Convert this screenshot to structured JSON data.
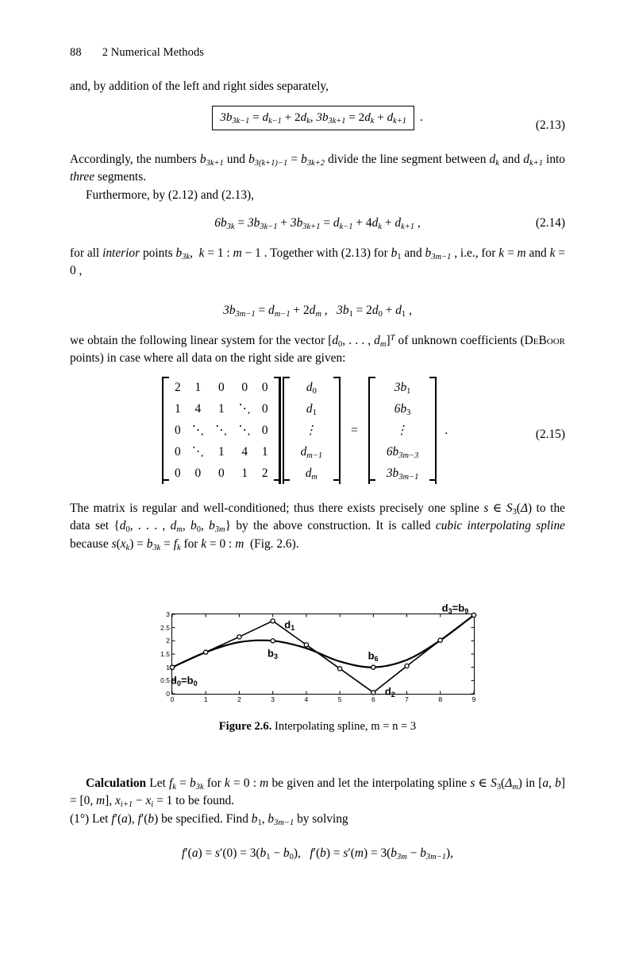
{
  "page": {
    "number": "88",
    "chapter_title": "2  Numerical Methods"
  },
  "body": {
    "para1": "and, by addition of the left and right sides separately,",
    "eq213": {
      "number": "(2.13)",
      "content": "3b_{3k-1} = d_{k-1} + 2d_k,  3b_{3k+1} = 2d_k + d_{k+1}",
      "trailing": "."
    },
    "para2_line1": "Accordingly, the numbers b_{3k+1} und b_{3(k+1)-1} = b_{3k+2} divide the line segment",
    "para2_line2": "between d_k and d_{k+1} into three segments.",
    "para3": "Furthermore, by (2.12) and (2.13),",
    "eq214": {
      "number": "(2.14)",
      "content": "6b_{3k} = 3b_{3k-1} + 3b_{3k+1} = d_{k-1} + 4d_k + d_{k+1} ,"
    },
    "para4_line1": "for all interior points b_{3k}, k = 1 : m - 1. Together with (2.13) for b_1 and",
    "para4_line2": "b_{3m-1}, i.e., for k = m and k = 0,",
    "eq_unnumbered": "3b_{3m-1} = d_{m-1} + 2d_m ,   3b_1 = 2d_0 + d_1 ,",
    "para5_line1": "we obtain the following linear system for the vector [d_0, ... , d_m]^T of unknown",
    "para5_line2": "coefficients (DeBoor points) in case where all data on the right side are given:",
    "eq215": {
      "number": "(2.15)",
      "trailing": ".",
      "matrix": [
        [
          "2",
          "1",
          "0",
          "0",
          "0"
        ],
        [
          "1",
          "4",
          "1",
          "⋱",
          "0"
        ],
        [
          "0",
          "⋱",
          "⋱",
          "⋱",
          "0"
        ],
        [
          "0",
          "⋱",
          "1",
          "4",
          "1"
        ],
        [
          "0",
          "0",
          "0",
          "1",
          "2"
        ]
      ],
      "unknown_vector": [
        "d₀",
        "d₁",
        "⋮",
        "d_{m-1}",
        "d_m"
      ],
      "rhs_vector": [
        "3b₁",
        "6b₃",
        "⋮",
        "6b_{3m-3}",
        "3b_{3m-1}"
      ],
      "equals": "="
    },
    "para6": "The matrix is regular and well-conditioned; thus there exists precisely one spline s ∈ S_3(Δ) to the data set {d_0, ... , d_m, b_0, b_{3m}} by the above construction. It is called cubic interpolating spline because s(x_k) = b_{3k} = f_k for k = 0 : m (Fig. 2.6).",
    "calc_heading": "Calculation",
    "calc_line1": "Let f_k = b_{3k} for k = 0 : m be given and let the interpolating",
    "calc_line2": "spline s ∈ S_3(Δ_m) in [a, b] = [0, m], x_{i+1} - x_i = 1 to be found.",
    "calc_line3": "(1°) Let f'(a), f'(b) be specified. Find b_1, b_{3m-1} by solving",
    "eq_final": "f'(a) = s'(0) = 3(b_1 - b_0),   f'(b) = s'(m) = 3(b_{3m} - b_{3m-1}),"
  },
  "figure": {
    "caption_bold": "Figure 2.6.",
    "caption_rest": "Interpolating spline, m = n = 3"
  },
  "chart_data": {
    "type": "line",
    "title": "Interpolating spline, m = n = 3",
    "xlabel": "",
    "ylabel": "",
    "xlim": [
      0,
      9
    ],
    "ylim": [
      0,
      3
    ],
    "grid": false,
    "legend": null,
    "xticks": [
      "0",
      "1",
      "2",
      "3",
      "4",
      "5",
      "6",
      "7",
      "8",
      "9"
    ],
    "yticks": [
      "0",
      "0.5",
      "1",
      "1.5",
      "2",
      "2.5",
      "3"
    ],
    "series": [
      {
        "name": "control polygon (Bezier/DeBoor points)",
        "style": "polyline-with-open-circle-markers",
        "x": [
          0,
          1,
          2,
          3,
          4,
          5,
          6,
          7,
          8,
          9
        ],
        "y": [
          1.0,
          1.57,
          2.15,
          2.75,
          1.85,
          0.95,
          0.05,
          1.05,
          2.02,
          2.97
        ]
      },
      {
        "name": "cubic interpolating spline s",
        "style": "smooth-curve",
        "x": [
          0,
          1,
          2,
          3,
          4,
          5,
          6,
          7,
          8,
          9
        ],
        "y": [
          1.0,
          1.57,
          1.95,
          2.0,
          1.72,
          1.22,
          1.0,
          1.28,
          2.02,
          2.97
        ]
      },
      {
        "name": "spline knot points b_3k",
        "style": "open-circle-markers",
        "x": [
          0,
          3,
          6,
          9
        ],
        "y": [
          1.0,
          2.0,
          1.0,
          2.97
        ]
      }
    ],
    "annotations": [
      {
        "text": "d₀=b₀",
        "x": 0.35,
        "y": 0.52
      },
      {
        "text": "d₁",
        "x": 3.5,
        "y": 2.62
      },
      {
        "text": "b₃",
        "x": 3.0,
        "y": 1.52
      },
      {
        "text": "b₆",
        "x": 6.0,
        "y": 1.45
      },
      {
        "text": "d₂",
        "x": 6.5,
        "y": 0.08
      },
      {
        "text": "d₃=b₉",
        "x": 8.45,
        "y": 3.25
      }
    ]
  }
}
